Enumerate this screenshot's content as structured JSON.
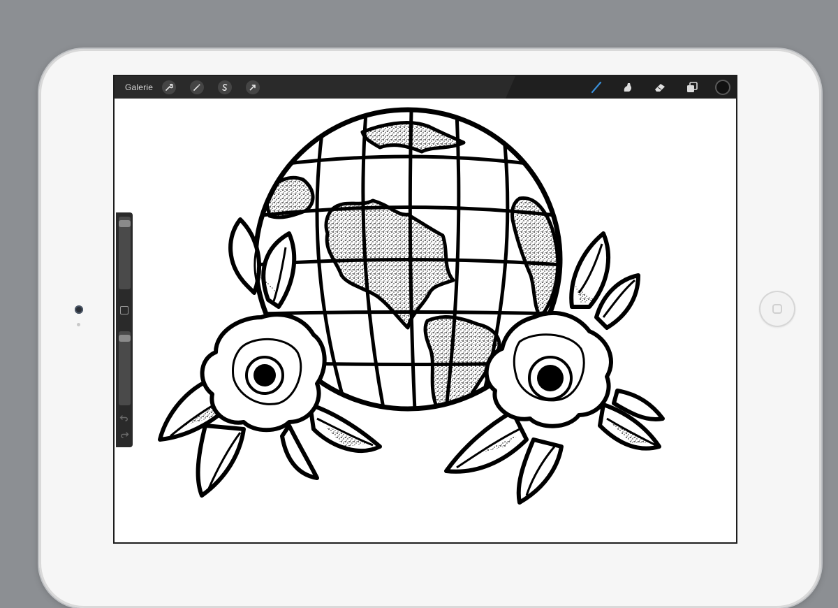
{
  "topbar": {
    "gallery_label": "Galerie",
    "left_tools": [
      "wrench-icon",
      "magic-wand-icon",
      "selection-icon",
      "transform-arrow-icon"
    ],
    "right_tools": [
      "brush-icon",
      "smudge-icon",
      "eraser-icon",
      "layers-icon"
    ],
    "active_tool": "brush-icon",
    "current_color": "#111111",
    "accent": "#3a8fd8"
  },
  "sidebar": {
    "brush_size_level": 0.05,
    "opacity_level": 0.05,
    "controls": [
      "modify-button",
      "undo-icon",
      "redo-icon"
    ]
  },
  "canvas": {
    "artwork": "globe-with-two-flowers-ink-drawing",
    "background": "#ffffff",
    "ink": "#000000"
  }
}
